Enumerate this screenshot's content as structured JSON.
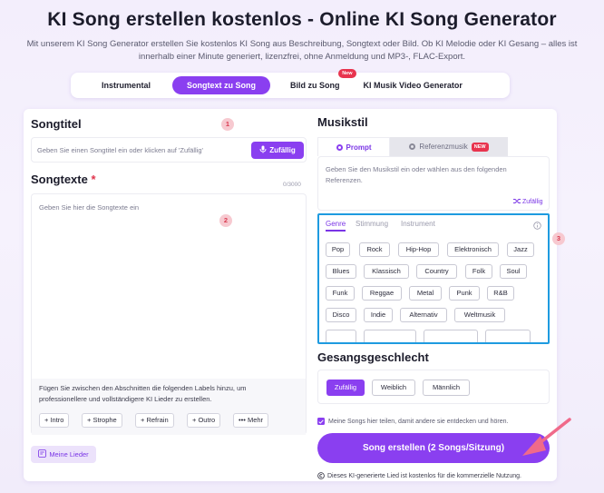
{
  "page": {
    "title": "KI Song erstellen kostenlos - Online KI Song Generator",
    "subtitle": "Mit unserem KI Song Generator erstellen Sie kostenlos KI Song aus Beschreibung, Songtext oder Bild. Ob KI Melodie oder KI Gesang – alles ist innerhalb einer Minute generiert, lizenzfrei, ohne Anmeldung und MP3-, FLAC-Export."
  },
  "mode_tabs": [
    {
      "label": "Instrumental",
      "active": false
    },
    {
      "label": "Songtext zu Song",
      "active": true
    },
    {
      "label": "Bild zu Song",
      "active": false,
      "badge": "New"
    },
    {
      "label": "KI Musik Video Generator",
      "active": false
    }
  ],
  "left": {
    "title_heading": "Songtitel",
    "title_placeholder": "Geben Sie einen Songtitel ein oder klicken auf 'Zufällig'",
    "random_label": "Zufällig",
    "step1": "1",
    "lyrics_heading": "Songtexte",
    "required_mark": "*",
    "lyrics_counter": "0/3000",
    "lyrics_placeholder": "Geben Sie hier die Songtexte ein",
    "step2": "2",
    "hint": "Fügen Sie zwischen den Abschnitten die folgenden Labels hinzu, um professionellere und vollständigere KI Lieder zu erstellen.",
    "labels": [
      "+ Intro",
      "+ Strophe",
      "+ Refrain",
      "+ Outro",
      "••• Mehr"
    ],
    "my_songs": "Meine Lieder"
  },
  "right": {
    "style_heading": "Musikstil",
    "style_tabs": [
      {
        "label": "Prompt",
        "active": true
      },
      {
        "label": "Referenzmusik",
        "active": false,
        "badge": "NEW"
      }
    ],
    "style_placeholder": "Geben Sie den Musikstil ein oder wählen aus den folgenden Referenzen.",
    "random_label": "Zufällig",
    "sub_tabs": [
      {
        "label": "Genre",
        "active": true
      },
      {
        "label": "Stimmung",
        "active": false
      },
      {
        "label": "Instrument",
        "active": false
      }
    ],
    "step3": "3",
    "genres": [
      [
        "Pop",
        "Rock",
        "Hip-Hop",
        "Elektronisch",
        "Jazz"
      ],
      [
        "Blues",
        "Klassisch",
        "Country",
        "Folk",
        "Soul"
      ],
      [
        "Funk",
        "Reggae",
        "Metal",
        "Punk",
        "R&B"
      ],
      [
        "Disco",
        "Indie",
        "Alternativ",
        "Weltmusik"
      ]
    ],
    "gender_heading": "Gesangsgeschlecht",
    "gender_options": [
      {
        "label": "Zufällig",
        "active": true
      },
      {
        "label": "Weiblich",
        "active": false
      },
      {
        "label": "Männlich",
        "active": false
      }
    ],
    "share_label": "Meine Songs hier teilen, damit andere sie entdecken und hören.",
    "create_button": "Song erstellen (2 Songs/Sitzung)",
    "footer_note": "Dieses KI-generierte Lied ist kostenlos für die kommerzielle Nutzung."
  },
  "colors": {
    "accent": "#8a3ff0",
    "highlight_border": "#1e9be0",
    "annotation_arrow": "#f06a8a"
  }
}
